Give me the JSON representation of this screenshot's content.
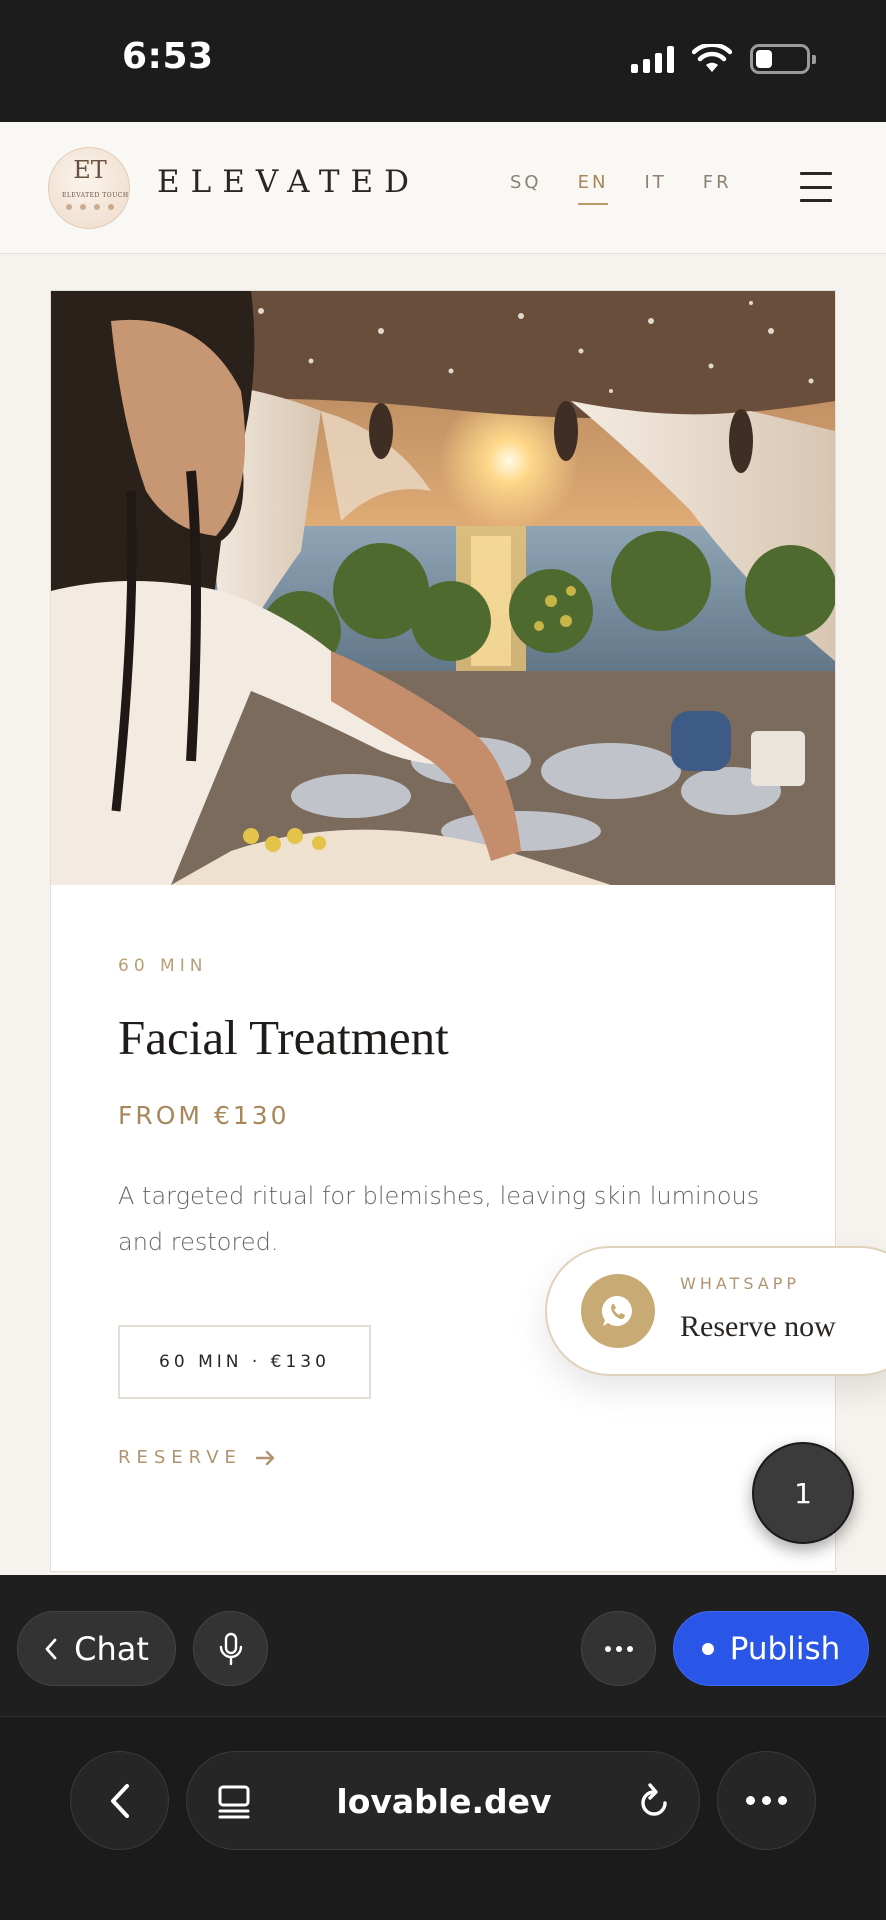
{
  "status_bar": {
    "time": "6:53",
    "icons": [
      "cellular-signal-icon",
      "wifi-icon",
      "battery-icon"
    ],
    "battery_level": 0.25
  },
  "site": {
    "logo": {
      "monogram": "ET",
      "subtitle": "ELEVATED TOUCH"
    },
    "brand": "ELEVATED",
    "languages": [
      {
        "code": "SQ",
        "active": false
      },
      {
        "code": "EN",
        "active": true
      },
      {
        "code": "IT",
        "active": false
      },
      {
        "code": "FR",
        "active": false
      }
    ],
    "menu_icon": "hamburger-menu-icon"
  },
  "service_card": {
    "image": "massage-cabana-at-sunset",
    "duration": "60 MIN",
    "title": "Facial Treatment",
    "price": "FROM €130",
    "description": "A targeted ritual for blemishes, leaving skin luminous and restored.",
    "option_chip": "60 MIN · €130",
    "reserve_link": "RESERVE",
    "reserve_icon": "arrow-right-icon"
  },
  "whatsapp_float": {
    "label": "WHATSAPP",
    "cta": "Reserve now",
    "icon": "whatsapp-icon"
  },
  "floating_badge": {
    "count": "1"
  },
  "app_toolbar": {
    "chat_label": "Chat",
    "chat_icon": "chevron-left-icon",
    "mic_icon": "microphone-icon",
    "more_icon": "more-horizontal-icon",
    "publish_label": "Publish"
  },
  "browser_bar": {
    "url": "lovable.dev",
    "back_icon": "chevron-left-icon",
    "tabs_icon": "tab-overview-icon",
    "reload_icon": "reload-icon",
    "more_icon": "more-horizontal-icon"
  },
  "colors": {
    "accent_gold": "#a8875a",
    "publish_blue": "#2a56e8",
    "page_background": "#f6f3ee",
    "whatsapp_icon_bg": "#c8aa74"
  }
}
